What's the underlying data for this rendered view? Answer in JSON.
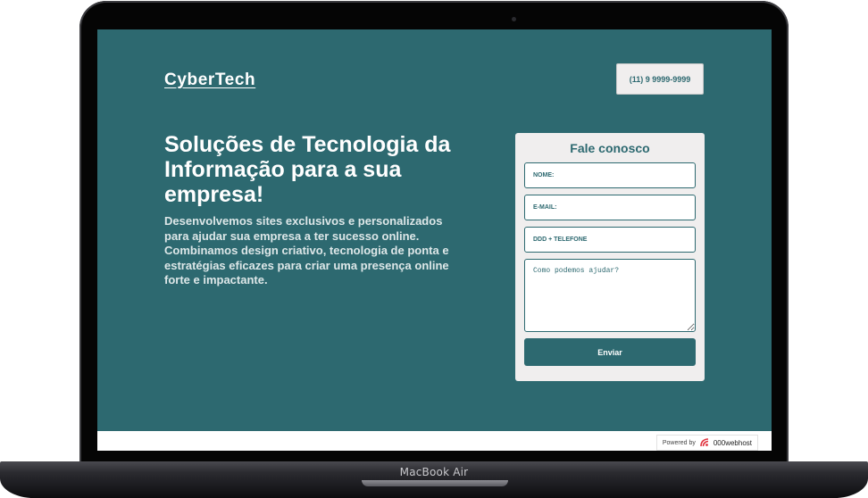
{
  "device": {
    "base_label": "MacBook Air"
  },
  "header": {
    "logo": "CyberTech",
    "phone": "(11) 9 9999-9999"
  },
  "hero": {
    "headline": "Soluções de Tecnologia da Informação para a sua empresa!",
    "subtext": "Desenvolvemos sites exclusivos e personalizados para ajudar sua empresa a ter sucesso online. Combinamos design criativo, tecnologia de ponta e estratégias eficazes para criar uma presença online forte e impactante."
  },
  "contact_form": {
    "title": "Fale conosco",
    "name_placeholder": "NOME:",
    "email_placeholder": "E-MAIL:",
    "phone_placeholder": "DDD + TELEFONE",
    "message_placeholder": "Como podemos ajudar?",
    "submit_label": "Enviar"
  },
  "footer": {
    "powered_by": "Powered by",
    "host_brand": "000webhost"
  },
  "colors": {
    "primary": "#2d6970",
    "card_background": "#f0eeee",
    "host_logo": "#e0333e"
  },
  "icons": {
    "host_logo": "000webhost-logo-icon"
  }
}
